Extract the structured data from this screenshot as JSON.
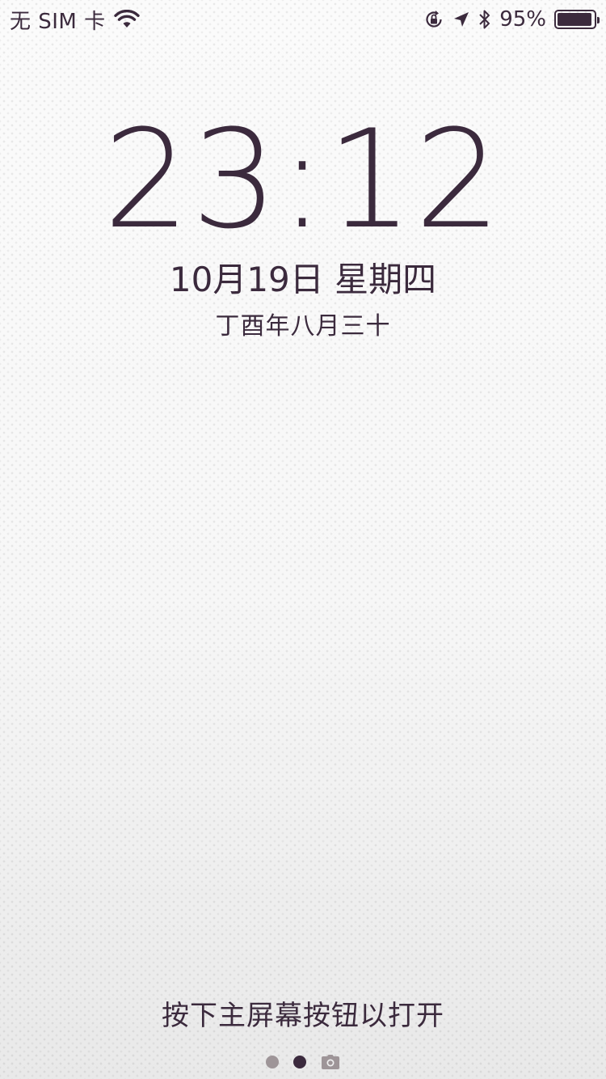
{
  "status_bar": {
    "carrier": "无 SIM 卡",
    "battery_percent_text": "95%",
    "battery_level": 0.95,
    "icons": [
      "wifi-icon",
      "orientation-lock-icon",
      "location-arrow-icon",
      "bluetooth-icon",
      "battery-icon"
    ]
  },
  "lock_screen": {
    "time": "23:12",
    "date": "10月19日 星期四",
    "lunar_date": "丁酉年八月三十",
    "unlock_hint": "按下主屏幕按钮以打开"
  },
  "page_indicator": {
    "pages": 2,
    "active_index": 1,
    "trailing_icon": "camera-icon"
  },
  "colors": {
    "text": "#3b2a3d",
    "inactive_dot": "#9e9598",
    "background_top": "#fbfbfb",
    "background_bottom": "#e9e9e9"
  }
}
